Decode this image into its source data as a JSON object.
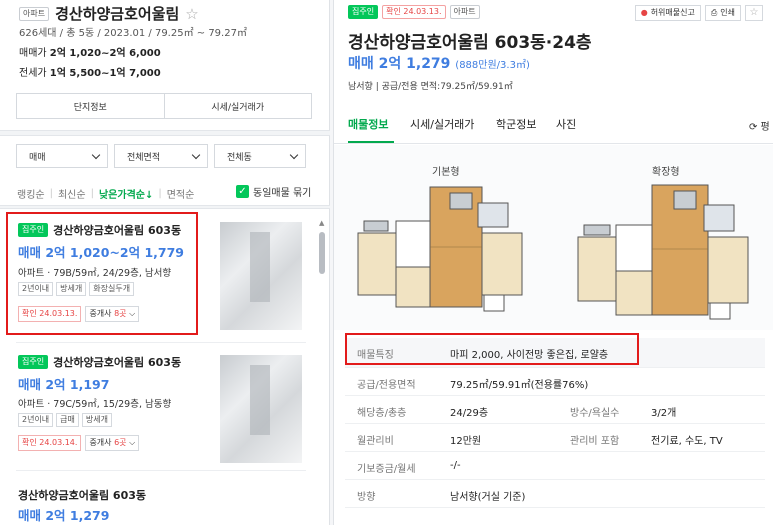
{
  "left": {
    "apt_tag": "아파트",
    "complex_name": "경산하양금호어울림",
    "star": "☆",
    "sub": "626세대 / 총 5동 / 2023.01 / 79.25㎡ ~ 79.27㎡",
    "sale_label": "매매가",
    "sale_value": "2억 1,020~2억 6,000",
    "rent_label": "전세가",
    "rent_value": "1억 5,500~1억 7,000",
    "buttons": [
      "단지정보",
      "시세/실거래가"
    ],
    "filters": [
      "매매",
      "전체면적",
      "전체동"
    ],
    "sort": [
      "랭킹순",
      "최신순",
      "낮은가격순↓",
      "면적순"
    ],
    "same_listing_label": "동일매물 묶기",
    "check": "✓"
  },
  "listings": [
    {
      "badge": "집주인",
      "title": "경산하양금호어울림 603동",
      "price": "매매 2억 1,020~2억 1,779",
      "info": "아파트 · 79B/59㎡, 24/29층, 남서향",
      "tags": [
        "2년이내",
        "방세개",
        "화장실두개"
      ],
      "confirm": "확인 24.03.13.",
      "agent_prefix": "중개사 ",
      "agent_count": "8곳",
      "chev": "⌵"
    },
    {
      "badge": "집주인",
      "title": "경산하양금호어울림 603동",
      "price": "매매 2억 1,197",
      "info": "아파트 · 79C/59㎡, 15/29층, 남동향",
      "tags": [
        "2년이내",
        "급매",
        "방세개"
      ],
      "confirm": "확인 24.03.14.",
      "agent_prefix": "중개사 ",
      "agent_count": "6곳",
      "chev": "⌵"
    },
    {
      "title": "경산하양금호어울림 603동",
      "price": "매매 2억 1,279"
    }
  ],
  "right": {
    "badge": "집주인",
    "confirm": "확인 24.03.13.",
    "apt_tag": "아파트",
    "report": "허위매물신고",
    "print": "인쇄",
    "star": "☆",
    "title": "경산하양금호어울림 603동·24층",
    "price": "매매 2억 1,279",
    "price_per": "(888만원/3.3㎡)",
    "sub": "남서향 | 공급/전용 면적:79.25㎡/59.91㎡",
    "tabs": [
      "매물정보",
      "시세/실거래가",
      "학군정보",
      "사진"
    ],
    "refresh": "⟳ 평",
    "plan_labels": [
      "기본형",
      "확장형"
    ],
    "rows": [
      {
        "label": "매물특징",
        "value": "마피 2,000, 사이전망 좋은집, 로얄층"
      },
      {
        "label": "공급/전용면적",
        "value": "79.25㎡/59.91㎡(전용률76%)"
      },
      {
        "label": "해당층/총층",
        "value": "24/29층",
        "label2": "방수/욕실수",
        "value2": "3/2개"
      },
      {
        "label": "월관리비",
        "value": "12만원",
        "label2": "관리비 포함",
        "value2": "전기료, 수도, TV"
      },
      {
        "label": "기보증금/월세",
        "value": "-/-"
      },
      {
        "label": "방향",
        "value": "남서향(거실 기준)"
      }
    ]
  },
  "colors": {
    "green": "#03c75a",
    "blue": "#3f7de0",
    "red": "#e21b1b"
  }
}
